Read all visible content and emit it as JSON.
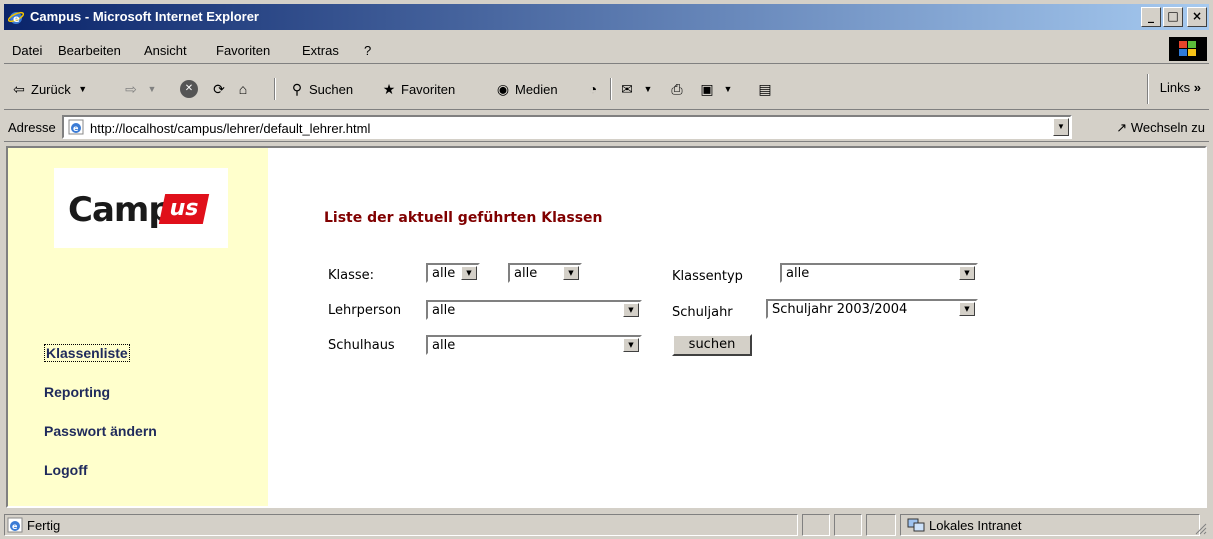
{
  "window": {
    "title": "Campus - Microsoft Internet Explorer",
    "controls": {
      "minimize": "_",
      "maximize": "□",
      "close": "×"
    }
  },
  "menubar": {
    "items": [
      {
        "label": "Datei"
      },
      {
        "label": "Bearbeiten"
      },
      {
        "label": "Ansicht"
      },
      {
        "label": "Favoriten"
      },
      {
        "label": "Extras"
      },
      {
        "label": "?"
      }
    ]
  },
  "toolbar": {
    "back_label": "Zurück",
    "search_label": "Suchen",
    "favorites_label": "Favoriten",
    "media_label": "Medien",
    "links_label": "Links"
  },
  "addressbar": {
    "label": "Adresse",
    "url": "http://localhost/campus/lehrer/default_lehrer.html",
    "go_label": "Wechseln zu"
  },
  "sidebar": {
    "logo_text": "Camp",
    "logo_badge": "us",
    "nav": [
      {
        "label": "Klassenliste"
      },
      {
        "label": "Reporting"
      },
      {
        "label": "Passwort ändern"
      },
      {
        "label": "Logoff"
      }
    ]
  },
  "main": {
    "title": "Liste der aktuell geführten Klassen",
    "klasse_label": "Klasse:",
    "klasse_value1": "alle",
    "klasse_value2": "alle",
    "klassentyp_label": "Klassentyp",
    "klassentyp_value": "alle",
    "lehrperson_label": "Lehrperson",
    "lehrperson_value": "alle",
    "schuljahr_label": "Schuljahr",
    "schuljahr_value": "Schuljahr 2003/2004",
    "schulhaus_label": "Schulhaus",
    "schulhaus_value": "alle",
    "search_button": "suchen"
  },
  "statusbar": {
    "status_text": "Fertig",
    "zone_text": "Lokales Intranet"
  },
  "colors": {
    "title_bar": "#0a246a",
    "sidebar_bg": "#ffffcc",
    "heading": "#800000",
    "nav_link": "#1f2a5c",
    "logo_red": "#e0101a"
  }
}
